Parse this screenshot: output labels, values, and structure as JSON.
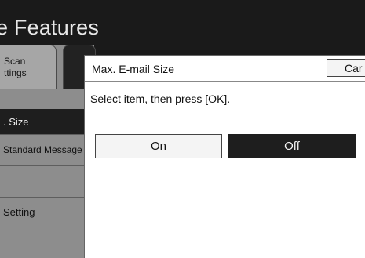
{
  "header": {
    "title": "e Features"
  },
  "sidebar": {
    "tab_scan": {
      "line1": "Scan",
      "line2": "ttings"
    },
    "items": [
      {
        "label": ". Size",
        "selected": true
      },
      {
        "label": "Standard Message",
        "selected": false
      },
      {
        "label": "",
        "selected": false
      },
      {
        "label": "Setting",
        "selected": false
      },
      {
        "label": "",
        "selected": false
      }
    ]
  },
  "dialog": {
    "title": "Max. E-mail Size",
    "cancel_label": "Car",
    "instruction": "Select item, then press [OK].",
    "options": [
      {
        "label": "On",
        "selected": false
      },
      {
        "label": "Off",
        "selected": true
      }
    ]
  },
  "colors": {
    "screen_bg": "#1a1a1a",
    "panel_bg": "#ffffff",
    "sidebar_bg": "#8d8d8d",
    "selected_bg": "#1e1e1e"
  }
}
